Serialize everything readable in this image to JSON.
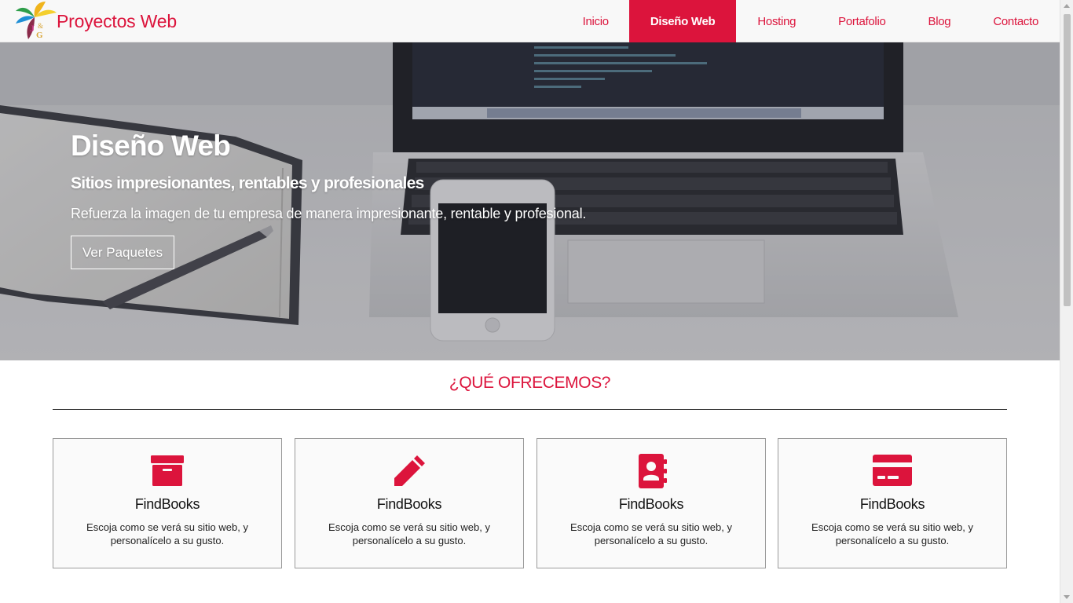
{
  "brand": {
    "name": "Proyectos Web",
    "logo_initials": "J&G",
    "accent": "#dc143c"
  },
  "nav": {
    "items": [
      {
        "label": "Inicio",
        "active": false
      },
      {
        "label": "Diseño Web",
        "active": true
      },
      {
        "label": "Hosting",
        "active": false
      },
      {
        "label": "Portafolio",
        "active": false
      },
      {
        "label": "Blog",
        "active": false
      },
      {
        "label": "Contacto",
        "active": false
      }
    ]
  },
  "hero": {
    "title": "Diseño Web",
    "subtitle": "Sitios impresionantes, rentables y profesionales",
    "description": "Refuerza la imagen de tu empresa de manera impresionante, rentable y profesional.",
    "button_label": "Ver Paquetes"
  },
  "offer": {
    "title": "¿QUÉ OFRECEMOS?",
    "cards": [
      {
        "icon": "archive-box-icon",
        "title": "FindBooks",
        "text": "Escoja como se verá su sitio web, y personalícelo a su gusto."
      },
      {
        "icon": "pencil-icon",
        "title": "FindBooks",
        "text": "Escoja como se verá su sitio web, y personalícelo a su gusto."
      },
      {
        "icon": "address-book-icon",
        "title": "FindBooks",
        "text": "Escoja como se verá su sitio web, y personalícelo a su gusto."
      },
      {
        "icon": "credit-card-icon",
        "title": "FindBooks",
        "text": "Escoja como se verá su sitio web, y personalícelo a su gusto."
      }
    ]
  }
}
